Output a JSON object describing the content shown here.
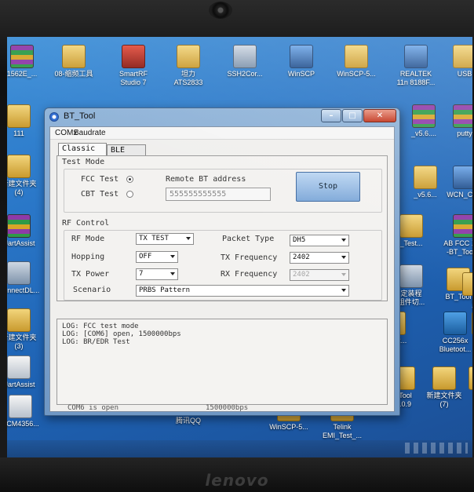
{
  "brand": "lenovo",
  "desktop_icons": [
    {
      "label": "1562E_...",
      "glyph": "rar"
    },
    {
      "label": "08-缩频工具",
      "glyph": "folder"
    },
    {
      "label": "SmartRF\nStudio 7",
      "glyph": "app"
    },
    {
      "label": "坦力\nATS2833",
      "glyph": "folder"
    },
    {
      "label": "SSH2Cor...",
      "glyph": "tool"
    },
    {
      "label": "WinSCP",
      "glyph": "net"
    },
    {
      "label": "WinSCP-5...",
      "glyph": "folder"
    },
    {
      "label": "REALTEK\n11n 8188F...",
      "glyph": "net"
    },
    {
      "label": "USB",
      "glyph": "folder"
    },
    {
      "label": "111",
      "glyph": "folder"
    },
    {
      "label": "新建文件夹\n(4)",
      "glyph": "folder"
    },
    {
      "label": "UartAssist",
      "glyph": "rar"
    },
    {
      "label": "ConnectDL...",
      "glyph": "tool"
    },
    {
      "label": "新建文件夹\n(3)",
      "glyph": "folder"
    },
    {
      "label": "UartAssist",
      "glyph": "doc"
    },
    {
      "label": "BCM4356...",
      "glyph": "doc"
    },
    {
      "label": "_v5.6....",
      "glyph": "rar"
    },
    {
      "label": "putty",
      "glyph": "rar"
    },
    {
      "label": "_v5.6...",
      "glyph": "folder"
    },
    {
      "label": "WCN_Co...",
      "glyph": "net"
    },
    {
      "label": "_Test...",
      "glyph": "folder"
    },
    {
      "label": "AB FCC 工具\n-BT_Tool ...",
      "glyph": "rar"
    },
    {
      "label": "定装程\n组件切...",
      "glyph": "tool"
    },
    {
      "label": "BT_Tool",
      "glyph": "folder"
    },
    {
      "label": "6\nT",
      "glyph": "folder"
    },
    {
      "label": "32022...",
      "glyph": "folder"
    },
    {
      "label": "CC256x\nBluetoot...",
      "glyph": "fcc"
    },
    {
      "label": "88",
      "glyph": "folder"
    },
    {
      "label": "_Tool\n1.0.9",
      "glyph": "folder"
    },
    {
      "label": "新建文件夹\n(7)",
      "glyph": "folder"
    },
    {
      "label": "882",
      "glyph": "folder"
    },
    {
      "label": "腾讯QQ",
      "glyph": "qq"
    },
    {
      "label": "WinSCP-5...",
      "glyph": "folder"
    },
    {
      "label": "Telink\nEMI_Test_...",
      "glyph": "folder"
    }
  ],
  "window": {
    "title": "BT_Tool",
    "menu": [
      "COMx",
      "Baudrate"
    ],
    "tabs": [
      "Classic",
      "BLE"
    ],
    "active_tab": "Classic",
    "test_mode": {
      "section_label": "Test Mode",
      "options": [
        {
          "label": "FCC Test",
          "selected": true
        },
        {
          "label": "CBT Test",
          "selected": false
        }
      ],
      "remote_label": "Remote BT address",
      "remote_value": "555555555555",
      "stop_button": "Stop"
    },
    "rf_control": {
      "section_label": "RF Control",
      "rf_mode_label": "RF Mode",
      "rf_mode_value": "TX TEST",
      "hopping_label": "Hopping",
      "hopping_value": "OFF",
      "tx_power_label": "TX Power",
      "tx_power_value": "7",
      "scenario_label": "Scenario",
      "scenario_value": "PRBS Pattern",
      "packet_type_label": "Packet Type",
      "packet_type_value": "DH5",
      "tx_freq_label": "TX Frequency",
      "tx_freq_value": "2402",
      "rx_freq_label": "RX Frequency",
      "rx_freq_value": "2402"
    },
    "log": [
      "LOG: FCC test mode",
      "LOG: [COM6] open, 1500000bps",
      "LOG: BR/EDR Test"
    ],
    "status": {
      "port": "COM6 is open",
      "baud": "1500000bps"
    }
  }
}
